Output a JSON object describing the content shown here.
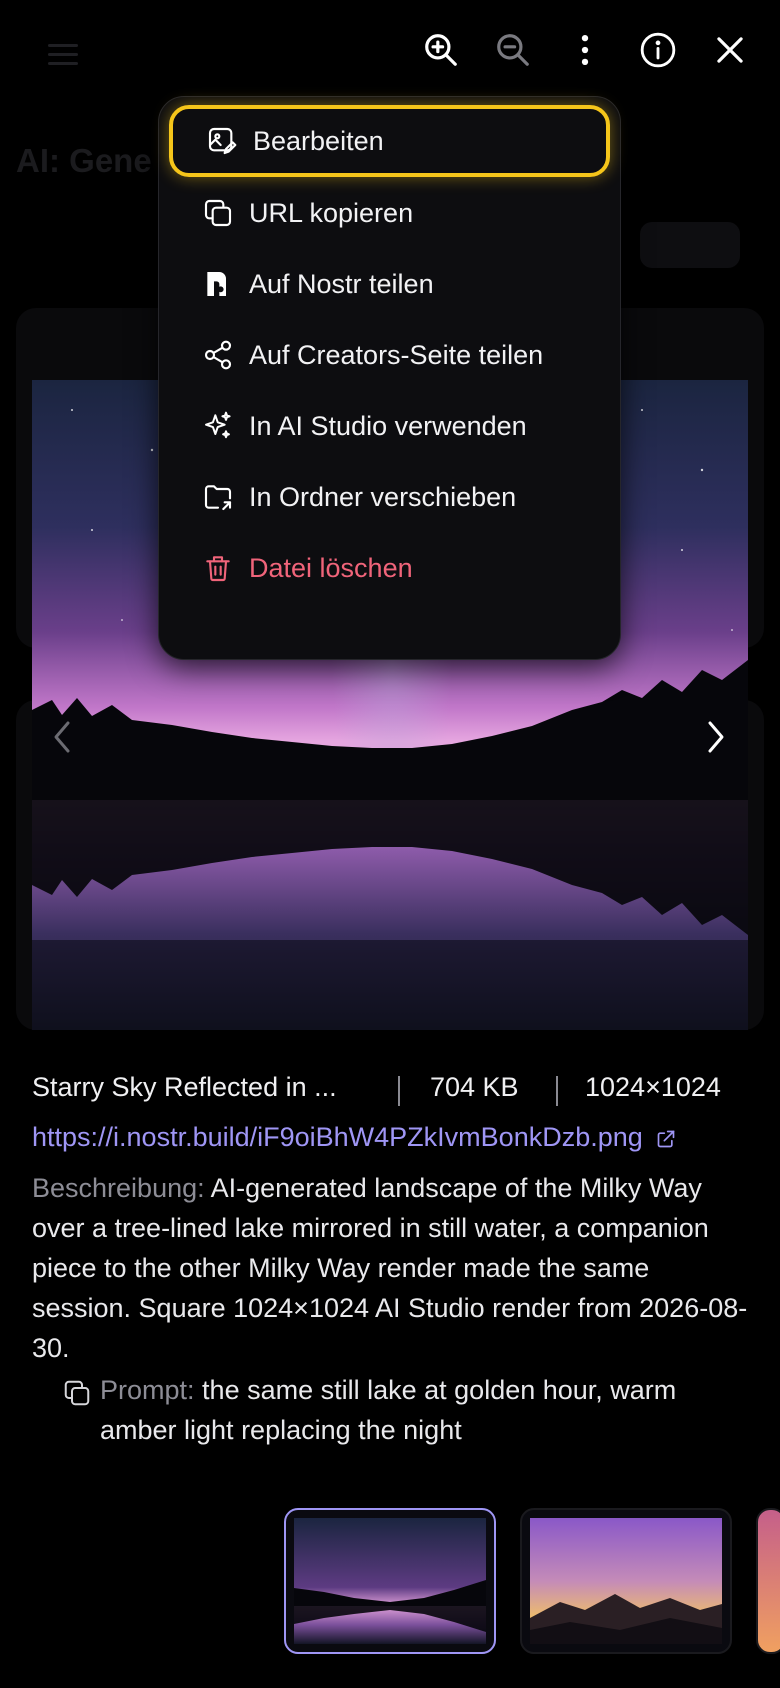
{
  "background": {
    "page_title": "AI: Gene"
  },
  "menu": {
    "items": [
      {
        "label": "Bearbeiten",
        "icon": "image-edit-icon"
      },
      {
        "label": "URL kopieren",
        "icon": "copy-icon"
      },
      {
        "label": "Auf Nostr teilen",
        "icon": "nostr-icon"
      },
      {
        "label": "Auf Creators-Seite teilen",
        "icon": "share-icon"
      },
      {
        "label": "In AI Studio verwenden",
        "icon": "sparkles-icon"
      },
      {
        "label": "In Ordner verschieben",
        "icon": "folder-move-icon"
      },
      {
        "label": "Datei löschen",
        "icon": "trash-icon"
      }
    ]
  },
  "toolbar": {
    "icons": [
      "zoom-in-icon",
      "zoom-out-icon",
      "more-vertical-icon",
      "info-icon",
      "close-icon"
    ]
  },
  "file": {
    "name": "Starry Sky Reflected in ...",
    "size": "704 KB",
    "dimensions": "1024×1024",
    "url": "https://i.nostr.build/iF9oiBhW4PZkIvmBonkDzb.png",
    "description_label": "Beschreibung:",
    "description": "AI-generated landscape of the Milky Way over a tree-lined lake mirrored in still water, a companion piece to the other Milky Way render made the same session. Square 1024×1024 AI Studio render from 2026-08-30.",
    "prompt_label": "Prompt:",
    "prompt": "the same still lake at golden hour, warm amber light replacing the night"
  },
  "colors": {
    "accent": "#9f96f5",
    "highlight": "#f5c51a",
    "danger": "#f0647a"
  }
}
